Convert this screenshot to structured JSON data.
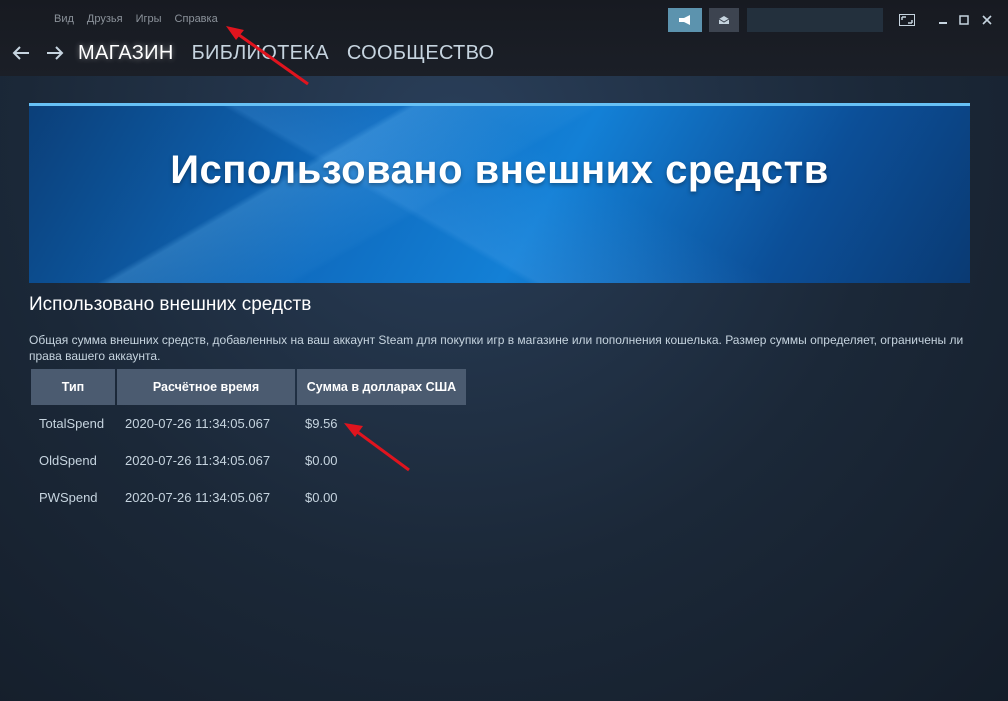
{
  "menu": {
    "items": [
      "Вид",
      "Друзья",
      "Игры",
      "Справка"
    ]
  },
  "toolbar": {
    "announce_icon": "megaphone-icon",
    "mail_icon": "envelope-icon"
  },
  "window_controls": {
    "fullscreen_icon": "fullscreen-icon",
    "minimize_icon": "minimize-icon",
    "maximize_icon": "maximize-icon",
    "close_icon": "close-icon"
  },
  "nav": {
    "back_icon": "arrow-left-icon",
    "forward_icon": "arrow-right-icon",
    "tabs": [
      "МАГАЗИН",
      "БИБЛИОТЕКА",
      "СООБЩЕСТВО"
    ],
    "active_tab": "МАГАЗИН"
  },
  "banner": {
    "title": "Использовано внешних средств"
  },
  "content": {
    "title": "Использовано внешних средств",
    "description": "Общая сумма внешних средств, добавленных на ваш аккаунт Steam для покупки игр в магазине или пополнения кошелька. Размер суммы определяет, ограничены ли права вашего аккаунта."
  },
  "table": {
    "headers": [
      "Тип",
      "Расчётное время",
      "Сумма в долларах США"
    ],
    "rows": [
      [
        "TotalSpend",
        "2020-07-26 11:34:05.067",
        "$9.56"
      ],
      [
        "OldSpend",
        "2020-07-26 11:34:05.067",
        "$0.00"
      ],
      [
        "PWSpend",
        "2020-07-26 11:34:05.067",
        "$0.00"
      ]
    ]
  },
  "colors": {
    "background": "#1b2838",
    "accent": "#67c1f5",
    "announce_button": "#5c93ae",
    "header_cell": "#4b5b70",
    "annotation_arrow": "#e0141e"
  }
}
